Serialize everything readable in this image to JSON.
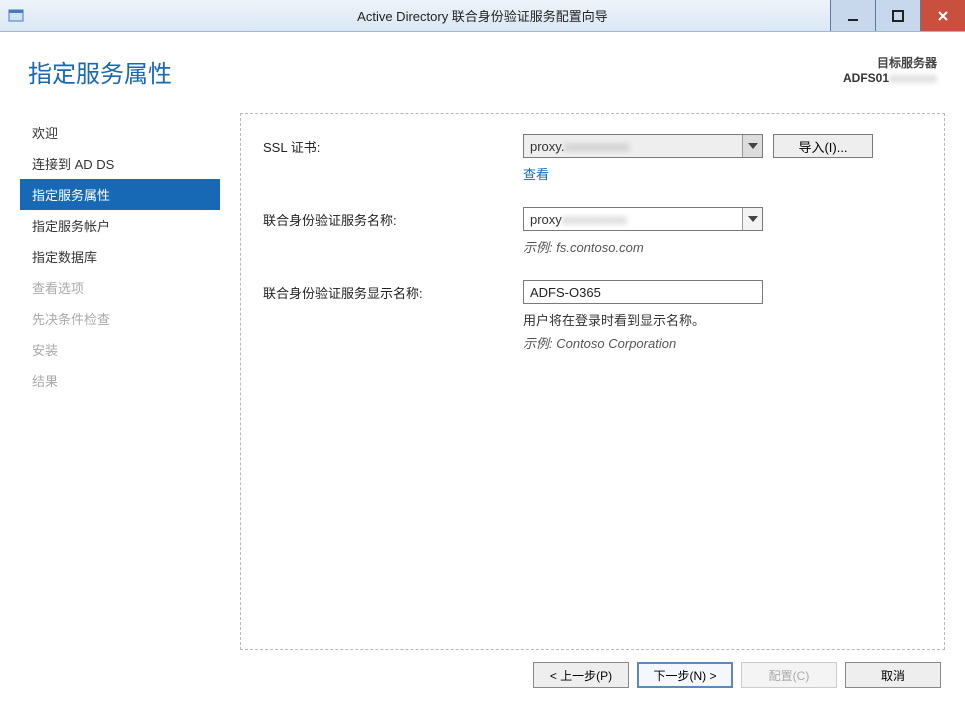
{
  "window": {
    "title": "Active Directory 联合身份验证服务配置向导"
  },
  "header": {
    "page_title": "指定服务属性",
    "target_label": "目标服务器",
    "target_value": "ADFS01"
  },
  "sidebar": {
    "items": [
      {
        "label": "欢迎",
        "state": "normal"
      },
      {
        "label": "连接到 AD DS",
        "state": "normal"
      },
      {
        "label": "指定服务属性",
        "state": "active"
      },
      {
        "label": "指定服务帐户",
        "state": "normal"
      },
      {
        "label": "指定数据库",
        "state": "normal"
      },
      {
        "label": "查看选项",
        "state": "disabled"
      },
      {
        "label": "先决条件检查",
        "state": "disabled"
      },
      {
        "label": "安装",
        "state": "disabled"
      },
      {
        "label": "结果",
        "state": "disabled"
      }
    ]
  },
  "form": {
    "ssl_cert_label": "SSL 证书:",
    "ssl_cert_value": "proxy.",
    "import_button": "导入(I)...",
    "view_link": "查看",
    "fed_name_label": "联合身份验证服务名称:",
    "fed_name_value": "proxy",
    "fed_name_example": "示例: fs.contoso.com",
    "display_name_label": "联合身份验证服务显示名称:",
    "display_name_value": "ADFS-O365",
    "display_name_hint": "用户将在登录时看到显示名称。",
    "display_name_example": "示例: Contoso Corporation"
  },
  "footer": {
    "prev": "< 上一步(P)",
    "next": "下一步(N) >",
    "configure": "配置(C)",
    "cancel": "取消"
  }
}
